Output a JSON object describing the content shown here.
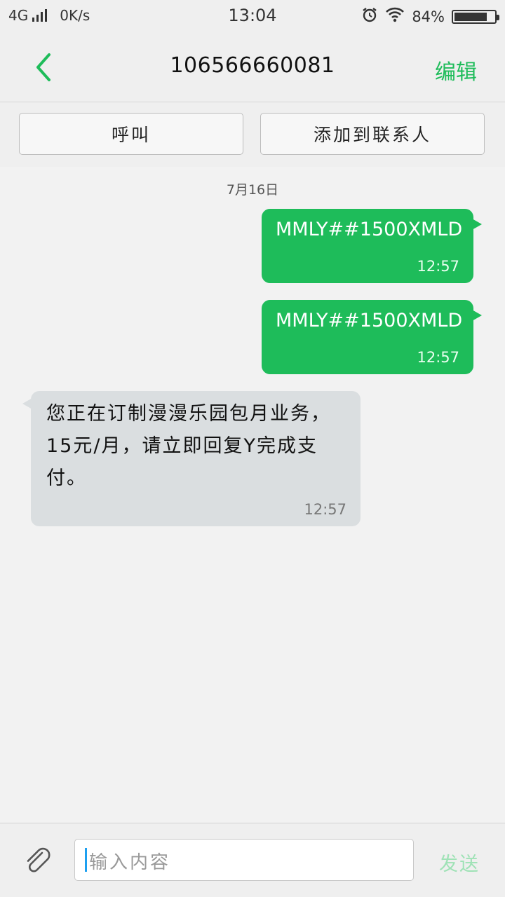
{
  "status_bar": {
    "network": "4G",
    "speed": "0K/s",
    "time": "13:04",
    "battery_percent": "84%",
    "battery_level": 0.84,
    "icons": [
      "signal-icon",
      "alarm-icon",
      "wifi-icon",
      "battery-icon"
    ]
  },
  "header": {
    "title": "106566660081",
    "edit_label": "编辑",
    "back_icon": "chevron-left-icon"
  },
  "actions": {
    "call_label": "呼叫",
    "add_contact_label": "添加到联系人"
  },
  "conversation": {
    "date": "7月16日",
    "messages": [
      {
        "direction": "out",
        "text": "MMLY##1500XMLD",
        "time": "12:57"
      },
      {
        "direction": "out",
        "text": "MMLY##1500XMLD",
        "time": "12:57"
      },
      {
        "direction": "in",
        "text": "您正在订制漫漫乐园包月业务，15元/月，请立即回复Y完成支付。",
        "time": "12:57"
      }
    ]
  },
  "input_bar": {
    "placeholder": "输入内容",
    "send_label": "发送",
    "attach_icon": "paperclip-icon"
  },
  "colors": {
    "accent": "#1ebc5a",
    "outgoing_bubble": "#1ebc5a",
    "incoming_bubble": "#dadee0",
    "send_disabled": "#9fe2b6"
  }
}
